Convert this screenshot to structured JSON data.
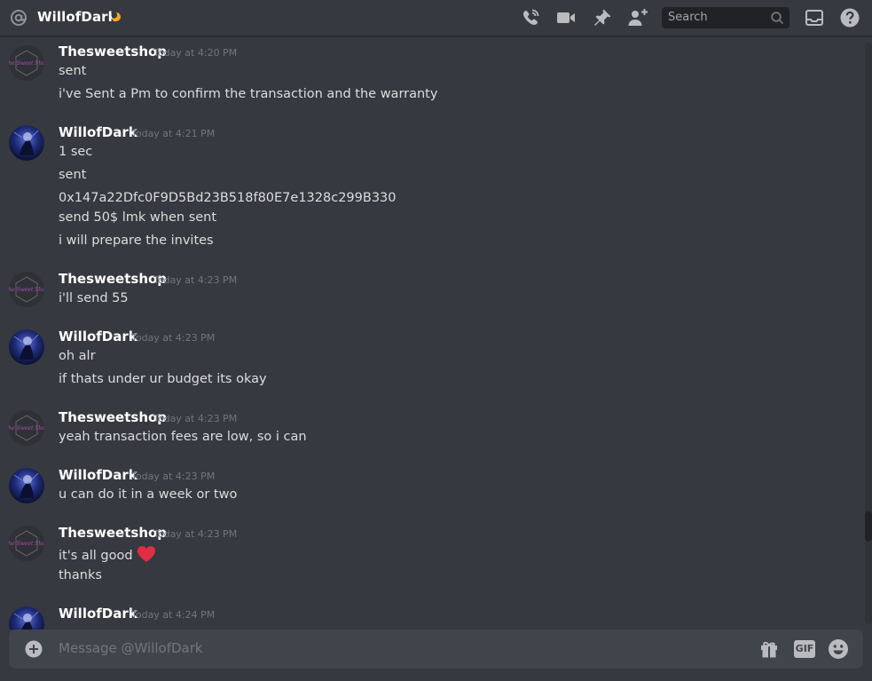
{
  "header": {
    "title": "WillofDark",
    "search_placeholder": "Search"
  },
  "messages": [
    {
      "author": "Thesweetshop",
      "timestamp": "Today at 4:20 PM",
      "avatar": "thesweetshop-logo",
      "lines": [
        "sent",
        "i've Sent a Pm to confirm the transaction and the warranty"
      ]
    },
    {
      "author": "WillofDark",
      "timestamp": "Today at 4:21 PM",
      "avatar": "willofdark-avatar",
      "lines": [
        "1 sec",
        "sent",
        "0x147a22Dfc0F9D5Bd23B518f80E7e1328c299B330",
        "send 50$ lmk when sent",
        "i will prepare the invites"
      ]
    },
    {
      "author": "Thesweetshop",
      "timestamp": "Today at 4:23 PM",
      "avatar": "thesweetshop-logo",
      "lines": [
        "i'll send 55"
      ]
    },
    {
      "author": "WillofDark",
      "timestamp": "Today at 4:23 PM",
      "avatar": "willofdark-avatar",
      "lines": [
        "oh alr",
        "if thats under ur budget its okay"
      ]
    },
    {
      "author": "Thesweetshop",
      "timestamp": "Today at 4:23 PM",
      "avatar": "thesweetshop-logo",
      "lines": [
        "yeah transaction fees are low, so i can"
      ]
    },
    {
      "author": "WillofDark",
      "timestamp": "Today at 4:23 PM",
      "avatar": "willofdark-avatar",
      "lines": [
        "u can do it in a week or two"
      ]
    },
    {
      "author": "Thesweetshop",
      "timestamp": "Today at 4:23 PM",
      "avatar": "thesweetshop-logo",
      "lines": [
        "it's all good",
        "thanks"
      ],
      "emoji": "heart-emoji"
    },
    {
      "author": "WillofDark",
      "timestamp": "Today at 4:24 PM",
      "avatar": "willofdark-avatar",
      "lines": []
    }
  ],
  "composer": {
    "placeholder": "Message @WillofDark",
    "gif_label": "GIF"
  },
  "colors": {
    "background": "#36393f",
    "composer": "#40444b",
    "heart": "#dd2e44"
  }
}
